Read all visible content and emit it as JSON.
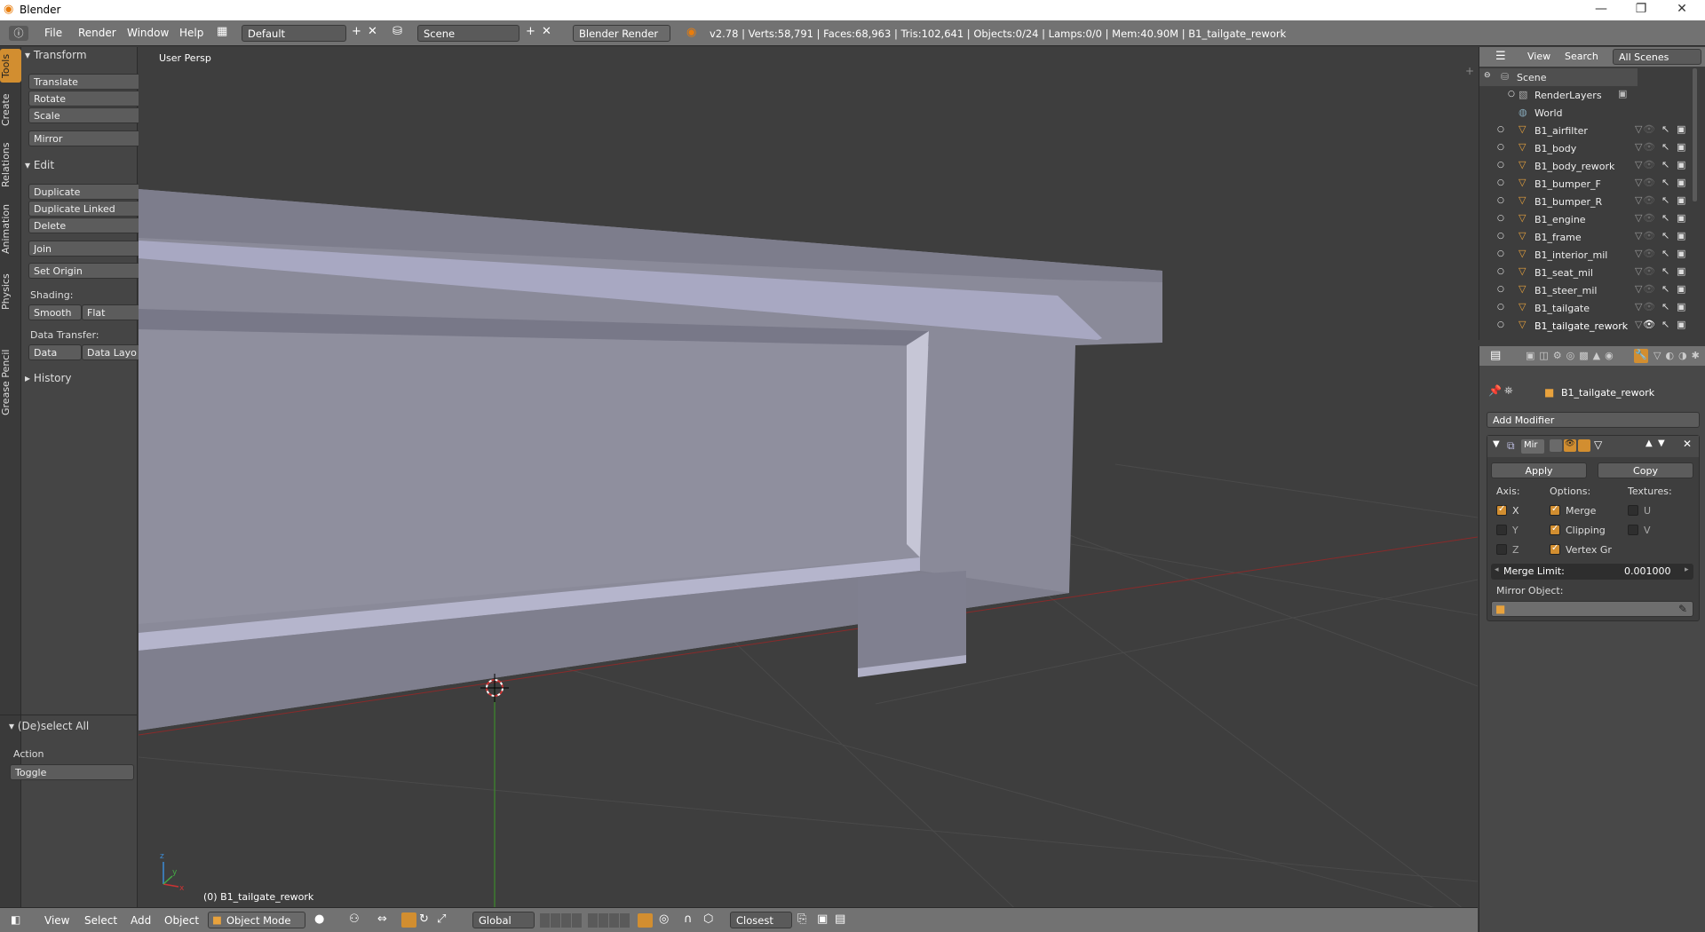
{
  "window": {
    "app_icon": "blender-logo-icon",
    "title": "Blender",
    "controls": [
      "—",
      "❐",
      "✕"
    ]
  },
  "info_bar": {
    "menus": [
      "File",
      "Render",
      "Window",
      "Help"
    ],
    "screen_layout": "Default",
    "scene": "Scene",
    "render_engine": "Blender Render",
    "stats": "v2.78 | Verts:58,791 | Faces:68,963 | Tris:102,641 | Objects:0/24 | Lamps:0/0 | Mem:40.90M | B1_tailgate_rework"
  },
  "tool_tabs": [
    "Tools",
    "Create",
    "Relations",
    "Animation",
    "Physics",
    "Grease Pencil"
  ],
  "tool_shelf": {
    "transform_title": "Transform",
    "translate": "Translate",
    "rotate": "Rotate",
    "scale": "Scale",
    "mirror": "Mirror",
    "edit_title": "Edit",
    "duplicate": "Duplicate",
    "duplicate_linked": "Duplicate Linked",
    "delete": "Delete",
    "join": "Join",
    "set_origin": "Set Origin",
    "shading_label": "Shading:",
    "smooth": "Smooth",
    "flat": "Flat",
    "data_transfer_label": "Data Transfer:",
    "data": "Data",
    "data_layo": "Data Layo",
    "history_title": "History",
    "operator_title": "(De)select All",
    "action_label": "Action",
    "action_value": "Toggle"
  },
  "viewport": {
    "view_name": "User Persp",
    "object_label": "(0) B1_tailgate_rework"
  },
  "viewport_header": {
    "menus": [
      "View",
      "Select",
      "Add",
      "Object"
    ],
    "mode": "Object Mode",
    "orientation": "Global",
    "snap_target": "Closest"
  },
  "outliner": {
    "header": {
      "view": "View",
      "search": "Search",
      "filter": "All Scenes"
    },
    "scene": "Scene",
    "render_layers": "RenderLayers",
    "world": "World",
    "objects": [
      "B1_airfilter",
      "B1_body",
      "B1_body_rework",
      "B1_bumper_F",
      "B1_bumper_R",
      "B1_engine",
      "B1_frame",
      "B1_interior_mil",
      "B1_seat_mil",
      "B1_steer_mil",
      "B1_tailgate",
      "B1_tailgate_rework"
    ]
  },
  "properties": {
    "context_object": "B1_tailgate_rework",
    "add_modifier": "Add Modifier",
    "modifier_name": "Mir",
    "apply": "Apply",
    "copy": "Copy",
    "axis_label": "Axis:",
    "options_label": "Options:",
    "textures_label": "Textures:",
    "x": "X",
    "y": "Y",
    "z": "Z",
    "merge": "Merge",
    "clipping": "Clipping",
    "vertex_gr": "Vertex Gr",
    "u": "U",
    "v": "V",
    "merge_limit_label": "Merge Limit:",
    "merge_limit_value": "0.001000",
    "mirror_object_label": "Mirror Object:",
    "axis_x": true,
    "axis_y": false,
    "axis_z": false,
    "opt_merge": true,
    "opt_clipping": true,
    "opt_vertex_groups": true,
    "tex_u": false,
    "tex_v": false
  },
  "colors": {
    "accent": "#d28e30",
    "header": "#727272",
    "panel": "#454545",
    "viewport": "#3e3e3e",
    "selected_text": "#ffffff"
  }
}
